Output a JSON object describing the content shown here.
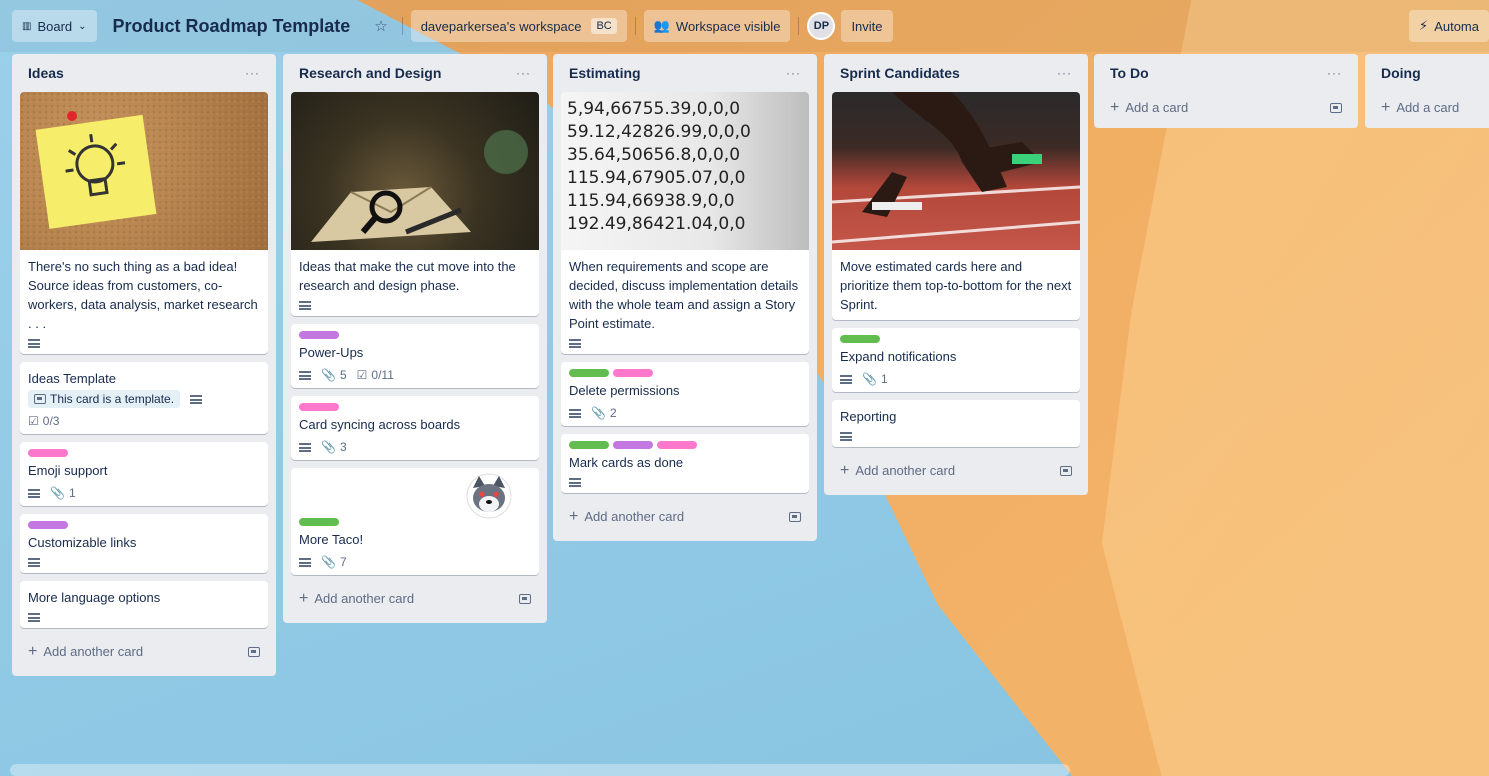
{
  "topbar": {
    "view_label": "Board",
    "board_title": "Product Roadmap Template",
    "workspace_label": "daveparkersea's workspace",
    "workspace_badge": "BC",
    "visibility_label": "Workspace visible",
    "avatar_initials": "DP",
    "invite_label": "Invite",
    "automation_label": "Automa"
  },
  "colors": {
    "pink": "#ff78cb",
    "purple": "#c377e0",
    "green": "#61bd4f"
  },
  "lists": {
    "ideas": {
      "title": "Ideas",
      "menu": "···",
      "card1": "There's no such thing as a bad idea! Source ideas from customers, co-workers, data analysis, market research . . .",
      "card2_title": "Ideas Template",
      "card2_chip": "This card is a template.",
      "card2_checklist": "0/3",
      "card3_title": "Emoji support",
      "card3_attach": "1",
      "card4_title": "Customizable links",
      "card5_title": "More language options",
      "add": "Add another card"
    },
    "research": {
      "title": "Research and Design",
      "menu": "···",
      "card1": "Ideas that make the cut move into the research and design phase.",
      "card2_title": "Power-Ups",
      "card2_attach": "5",
      "card2_checklist": "0/11",
      "card3_title": "Card syncing across boards",
      "card3_attach": "3",
      "card4_title": "More Taco!",
      "card4_attach": "7",
      "add": "Add another card"
    },
    "estimating": {
      "title": "Estimating",
      "menu": "···",
      "card1": "When requirements and scope are decided, discuss implementation details with the whole team and assign a Story Point estimate.",
      "card2_title": "Delete permissions",
      "card2_attach": "2",
      "card3_title": "Mark cards as done",
      "add": "Add another card",
      "cover_lines": [
        "5,94,66755.39,0,0,0",
        "59.12,42826.99,0,0,0",
        "35.64,50656.8,0,0,0",
        "115.94,67905.07,0,0",
        "115.94,66938.9,0,0",
        "192.49,86421.04,0,0"
      ]
    },
    "sprint": {
      "title": "Sprint Candidates",
      "menu": "···",
      "card1": "Move estimated cards here and prioritize them top-to-bottom for the next Sprint.",
      "card2_title": "Expand notifications",
      "card2_attach": "1",
      "card3_title": "Reporting",
      "add": "Add another card"
    },
    "todo": {
      "title": "To Do",
      "menu": "···",
      "add": "Add a card"
    },
    "doing": {
      "title": "Doing",
      "add": "Add a card"
    }
  }
}
